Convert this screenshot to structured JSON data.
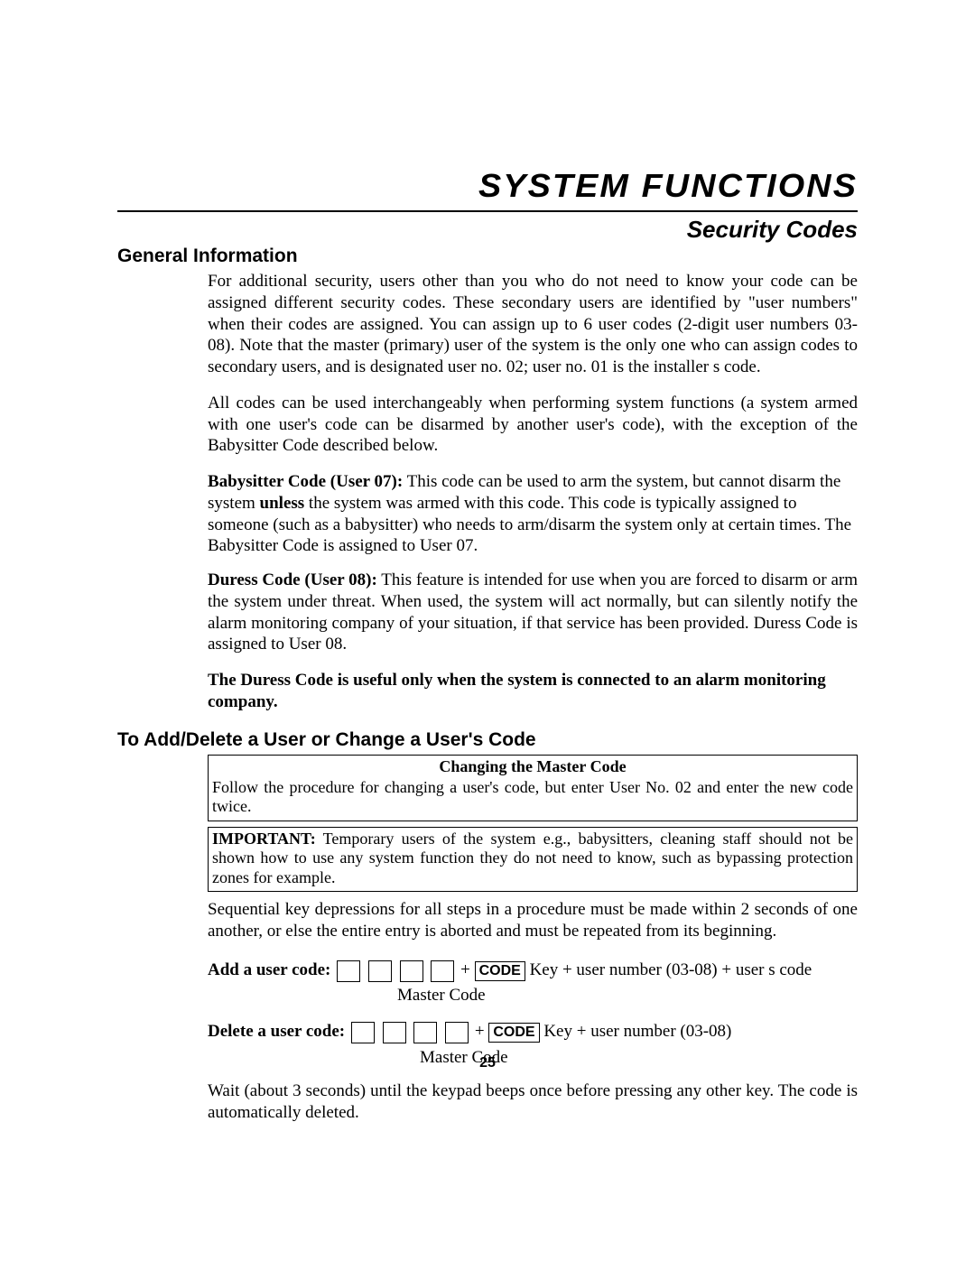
{
  "header": {
    "title": "SYSTEM FUNCTIONS",
    "subtitle": "Security Codes"
  },
  "sections": {
    "general": {
      "heading": "General Information",
      "p1": "For additional security, users other than you who do not need to know your code can be assigned different security codes. These secondary users are identified by \"user numbers\" when their codes are assigned. You can assign up to 6 user codes (2-digit user numbers 03-08). Note that the master (primary) user of the system is the only one who can assign codes to secondary users, and is designated user no. 02; user no. 01 is the installer s code.",
      "p2": "All codes can be used interchangeably when performing system functions (a system armed with one user's code can be disarmed by another user's code), with the exception of the Babysitter Code described below.",
      "p3_lead": "Babysitter Code (User 07):",
      "p3_pre": "  This code can be used to arm the system, but cannot disarm the system ",
      "p3_bold_inner": "unless",
      "p3_tail": " the system was armed with this code. This code is typically assigned to someone (such as a babysitter) who needs to arm/disarm the system only at certain times. The Babysitter Code is assigned to User 07.",
      "p4_lead": "Duress Code (User 08):",
      "p4_tail": "  This feature is intended for use when you are forced to disarm or arm the system under threat. When used, the system will act normally, but can silently notify the alarm monitoring company of your situation, if that service has been provided.  Duress Code is assigned to User 08.",
      "p5": "The Duress Code is useful only when the system is connected to an alarm monitoring company."
    },
    "adddel": {
      "heading": "To Add/Delete a User or Change a User's Code",
      "box": {
        "caption": "Changing the Master Code",
        "row1": "Follow the  procedure for changing a user's code, but enter User No. 02 and enter the new code twice.",
        "row2_lead": "IMPORTANT:",
        "row2_tail": " Temporary users of the system e.g., babysitters, cleaning staff should not be shown how to use any system function they do not need to know, such as bypassing protection zones for example."
      },
      "p_seq": "Sequential key depressions for all steps in a procedure must be made within 2 seconds of one another, or else the entire entry is aborted and must be repeated from its beginning.",
      "add": {
        "label": "Add a user code:",
        "plus": " + ",
        "codekey": "CODE",
        "tail": " Key + user number (03-08) + user s code",
        "sublabel": "Master Code"
      },
      "del": {
        "label": "Delete a user code:",
        "plus": " + ",
        "codekey": "CODE",
        "tail": " Key +  user number  (03-08)",
        "sublabel": "Master Code"
      },
      "p_wait": "Wait (about 3 seconds) until the keypad beeps once before pressing any other key. The code is automatically deleted."
    }
  },
  "page_number": "25"
}
